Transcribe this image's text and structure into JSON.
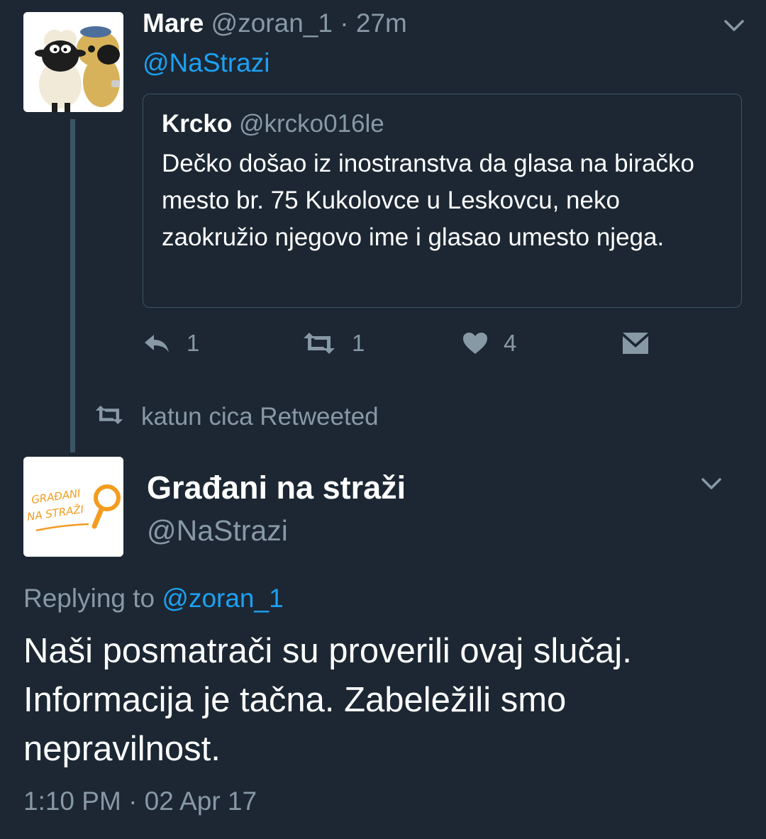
{
  "colors": {
    "background": "#1c2733",
    "muted": "#8899a6",
    "link": "#1da1f2",
    "border": "#3d5466"
  },
  "tweet1": {
    "name": "Mare",
    "handle": "@zoran_1",
    "time_separator": "·",
    "time": "27m",
    "mention": "@NaStrazi",
    "avatar_icon": "shaun-the-sheep-avatar",
    "menu_icon": "chevron-down-icon",
    "quote": {
      "name": "Krcko",
      "handle": "@krcko016le",
      "text": "Dečko došao iz inostranstva da glasa na biračko mesto br. 75 Kukolovce u Leskovcu, neko zaokružio njegovo ime i glasao umesto njega."
    },
    "actions": {
      "reply_icon": "reply-icon",
      "reply_count": "1",
      "retweet_icon": "retweet-icon",
      "retweet_count": "1",
      "like_icon": "heart-icon",
      "like_count": "4",
      "dm_icon": "direct-message-icon"
    }
  },
  "retweet_context": {
    "icon": "retweet-icon",
    "text": "katun cica Retweeted"
  },
  "tweet2": {
    "name": "Građani na straži",
    "handle": "@NaStrazi",
    "avatar_icon": "gradjani-na-strazi-logo",
    "avatar_logo_line1": "GRAĐANI",
    "avatar_logo_line2": "NA STRAŽI",
    "menu_icon": "chevron-down-icon",
    "replying_prefix": "Replying to",
    "replying_handle": "@zoran_1",
    "text": "Naši posmatrači su proverili ovaj slučaj. Informacija je tačna. Zabeležili smo nepravilnost.",
    "timestamp": "1:10 PM · 02 Apr 17"
  }
}
